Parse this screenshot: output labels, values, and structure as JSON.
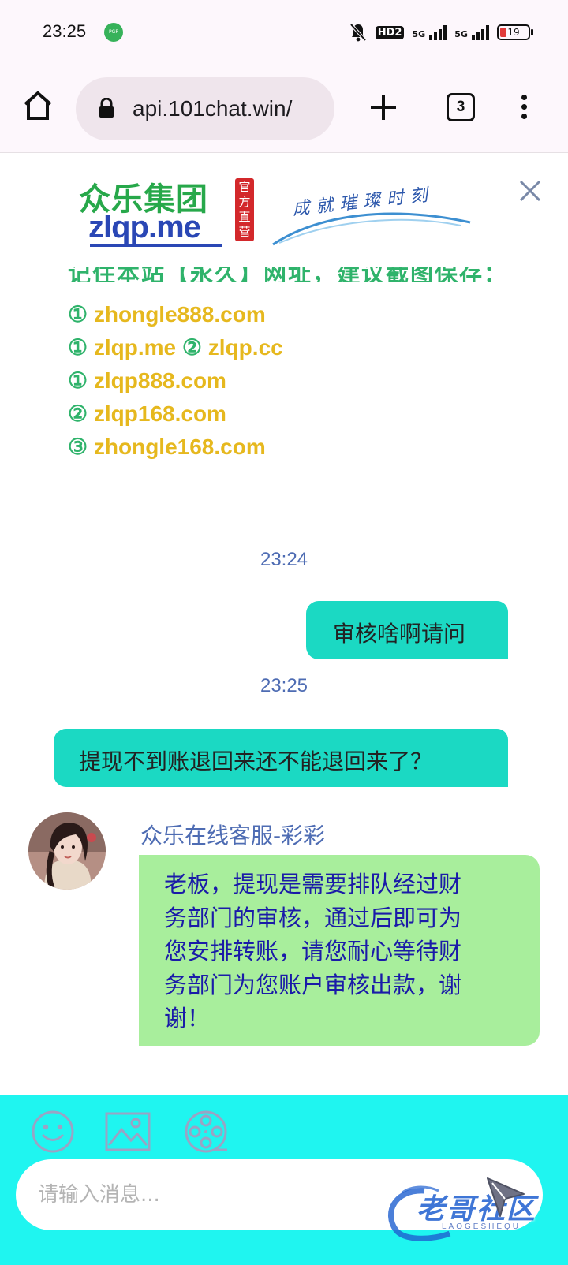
{
  "status_bar": {
    "time": "23:25",
    "vpn_badge": "PGP",
    "hd_label": "HD2",
    "sim1_label": "5G",
    "sim2_label": "5G",
    "battery_level": "19"
  },
  "browser": {
    "url": "api.101chat.win/",
    "tab_count": "3"
  },
  "banner": {
    "logo_cn": "众乐集团",
    "logo_en": "zlqp.me",
    "badge": "官方直营",
    "slogan": "成就璀璨时刻"
  },
  "notice": {
    "clipped_text": "记住本站【永久】网址，建议截图保存：",
    "domains": [
      {
        "marker": "①",
        "text": "zhongle888.com"
      },
      {
        "marker": "①",
        "text": "zlqp.me",
        "marker2": "②",
        "text2": "zlqp.cc"
      },
      {
        "marker": "①",
        "text": "zlqp888.com"
      },
      {
        "marker": "②",
        "text": "zlqp168.com"
      },
      {
        "marker": "③",
        "text": "zhongle168.com"
      }
    ]
  },
  "messages": {
    "time1": "23:24",
    "user_msg1": "审核啥啊请问",
    "time2": "23:25",
    "user_msg2": "提现不到账退回来还不能退回来了？",
    "agent_name": "众乐在线客服-彩彩",
    "agent_lines": [
      "老板，提现是需要排队经过财",
      "务部门的审核，通过后即可为",
      "您安排转账，请您耐心等待财",
      "务部门为您账户审核出款，谢",
      "谢！"
    ]
  },
  "input": {
    "placeholder": "请输入消息..."
  },
  "watermark": {
    "text": "老哥社区",
    "sub": "LAOGESHEQU"
  },
  "colors": {
    "user_bubble": "#1bd9c3",
    "agent_bubble": "#a8ee9c",
    "input_bar": "#1ff5f0",
    "timestamp": "#4e6cb3",
    "domain_text": "#e6b81e",
    "domain_marker": "#2fb36b"
  }
}
